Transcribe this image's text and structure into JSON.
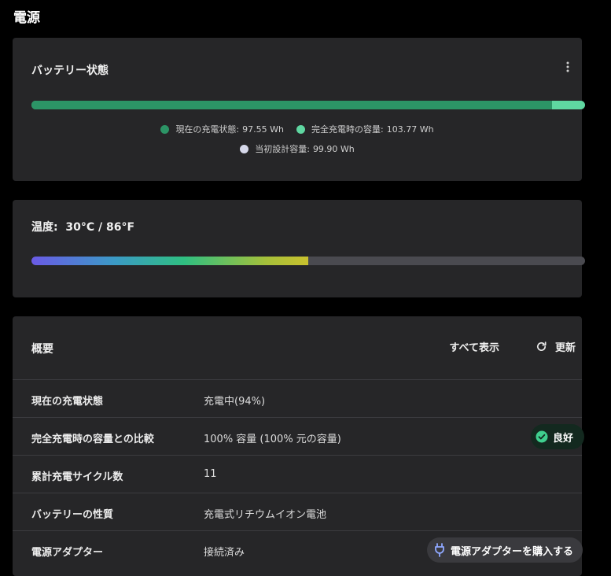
{
  "page": {
    "title": "電源"
  },
  "battery": {
    "title": "バッテリー状態",
    "current_fraction": 0.94,
    "legend": [
      {
        "label": "現在の充電状態:",
        "value": "97.55 Wh",
        "color": "#2c9466"
      },
      {
        "label": "完全充電時の容量:",
        "value": "103.77 Wh",
        "color": "#5fd7a1"
      },
      {
        "label": "当初設計容量:",
        "value": "99.90 Wh",
        "color": "#d6d8ea"
      }
    ]
  },
  "temperature": {
    "title": "温度:  30°C / 86°F",
    "fill_fraction": 0.5
  },
  "summary": {
    "title": "概要",
    "show_all_label": "すべて表示",
    "refresh_label": "更新",
    "rows": [
      {
        "label": "現在の充電状態",
        "value": "充電中(94%)"
      },
      {
        "label": "完全充電時の容量との比較",
        "value": "100% 容量 (100% 元の容量)",
        "badge": "良好"
      },
      {
        "label": "累計充電サイクル数",
        "value": "11"
      },
      {
        "label": "バッテリーの性質",
        "value": "充電式リチウムイオン電池"
      },
      {
        "label": "電源アダプター",
        "value": "接続済み",
        "button": "電源アダプターを購入する"
      }
    ]
  },
  "icons": {
    "more": "more-vertical-icon",
    "refresh": "refresh-icon",
    "check": "check-circle-icon",
    "plug": "plug-icon"
  },
  "colors": {
    "badge_good": "#3fcf8e",
    "plug_accent": "#8fa8ff"
  }
}
